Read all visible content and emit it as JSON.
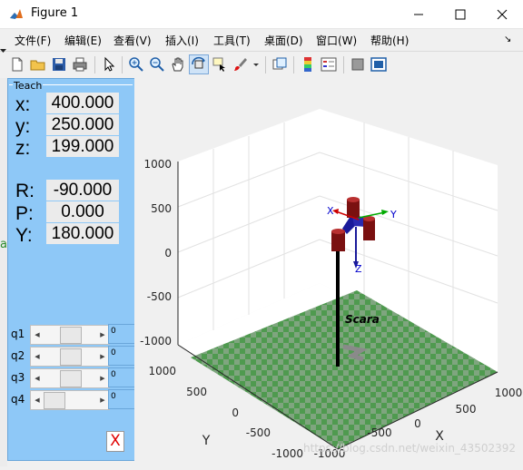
{
  "window": {
    "title": "Figure 1"
  },
  "menu": [
    "文件(F)",
    "编辑(E)",
    "查看(V)",
    "插入(I)",
    "工具(T)",
    "桌面(D)",
    "窗口(W)",
    "帮助(H)"
  ],
  "menu_extra": "↘",
  "toolbar": {
    "icons": [
      "new-figure-icon",
      "open-file-icon",
      "save-icon",
      "print-icon",
      "pointer-icon",
      "zoom-in-icon",
      "zoom-out-icon",
      "pan-hand-icon",
      "rotate-3d-icon",
      "data-cursor-icon",
      "brush-icon",
      "link-plot-icon",
      "colorbar-icon",
      "legend-icon",
      "hide-plot-tools-icon",
      "show-plot-tools-icon"
    ]
  },
  "teach": {
    "title": "Teach",
    "position": [
      {
        "label": "x:",
        "value": "400.000"
      },
      {
        "label": "y:",
        "value": "250.000"
      },
      {
        "label": "z:",
        "value": "199.000"
      }
    ],
    "orientation": [
      {
        "label": "R:",
        "value": "-90.000"
      },
      {
        "label": "P:",
        "value": "0.000"
      },
      {
        "label": "Y:",
        "value": "180.000"
      }
    ],
    "joints": [
      {
        "label": "q1",
        "value": "0",
        "fraction": 0.5
      },
      {
        "label": "q2",
        "value": "0",
        "fraction": 0.5
      },
      {
        "label": "q3",
        "value": "0",
        "fraction": 0.5
      },
      {
        "label": "q4",
        "value": "0",
        "fraction": 0.0
      }
    ],
    "close_label": "X"
  },
  "plot": {
    "z_ticks": [
      "1000",
      "500",
      "0",
      "-500",
      "-1000"
    ],
    "x_ticks": [
      "-1000",
      "-500",
      "0",
      "500",
      "1000"
    ],
    "y_ticks": [
      "1000",
      "500",
      "0",
      "-500",
      "-1000"
    ],
    "xlabel": "X",
    "ylabel": "Y",
    "robot_name": "Scara",
    "frame_labels": {
      "x": "X",
      "y": "Y",
      "z": "Z"
    },
    "watermark": "https://blog.csdn.net/weixin_43502392"
  },
  "edge_fragment": "a"
}
